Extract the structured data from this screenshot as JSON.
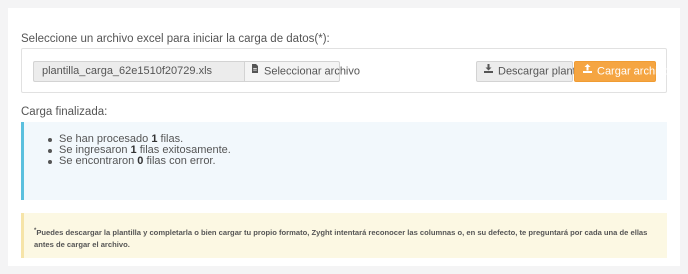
{
  "upload": {
    "prompt": "Seleccione un archivo excel para iniciar la carga de datos(*):",
    "file_name": "plantilla_carga_62e1510f20729.xls",
    "select_label": "Seleccionar archivo",
    "download_label": "Descargar plantilla",
    "upload_label": "Cargar archivo"
  },
  "status": {
    "label": "Carga finalizada:",
    "results": [
      {
        "pre": "Se han procesado ",
        "num": "1",
        "post": " filas."
      },
      {
        "pre": "Se ingresaron ",
        "num": "1",
        "post": " filas exitosamente."
      },
      {
        "pre": "Se encontraron ",
        "num": "0",
        "post": " filas con error."
      }
    ]
  },
  "note": {
    "mark": "*",
    "text": "Puedes descargar la plantilla y completarla o bien cargar tu propio formato, Zyght intentará reconocer las columnas o, en su defecto, te preguntará por cada una de ellas antes de cargar el archivo."
  },
  "icons": {
    "select": "file-icon",
    "download": "download-icon",
    "upload": "upload-icon"
  },
  "colors": {
    "accent": "#f5a542",
    "info_border": "#5bc0de",
    "info_bg": "#f2f8fc",
    "warning_bg": "#fcf8e3"
  }
}
